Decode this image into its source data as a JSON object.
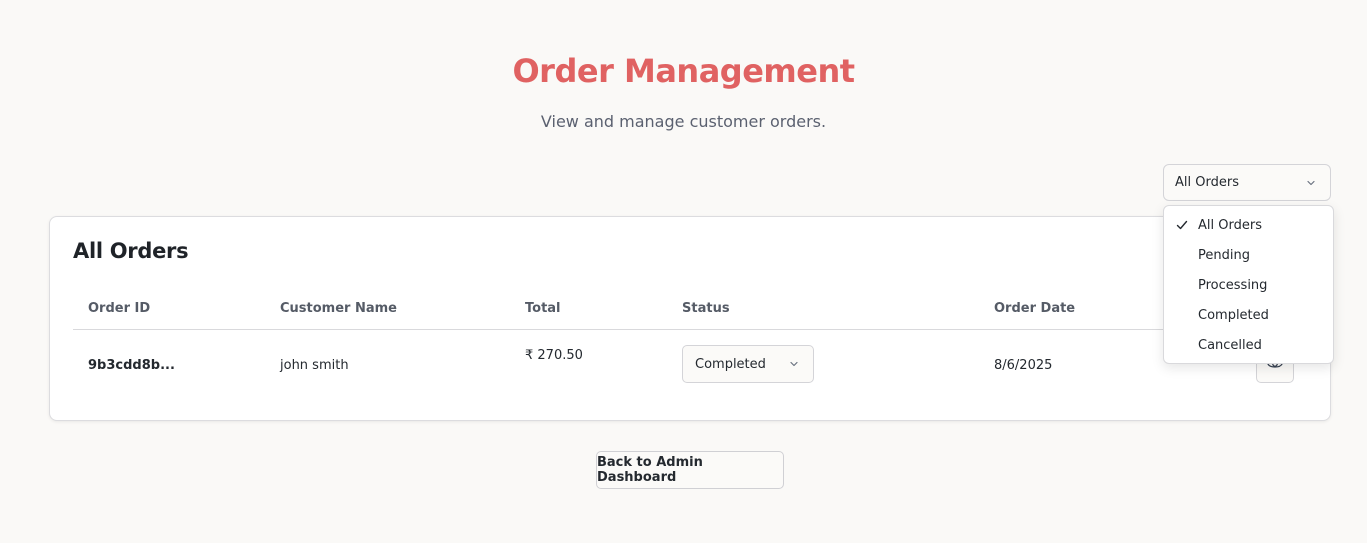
{
  "colors": {
    "accent": "#e06262"
  },
  "header": {
    "title": "Order Management",
    "subtitle": "View and manage customer orders."
  },
  "filter": {
    "selected": "All Orders",
    "options": [
      "All Orders",
      "Pending",
      "Processing",
      "Completed",
      "Cancelled"
    ]
  },
  "orders_card": {
    "title": "All Orders",
    "columns": [
      "Order ID",
      "Customer Name",
      "Total",
      "Status",
      "Order Date"
    ],
    "rows": [
      {
        "order_id": "9b3cdd8b...",
        "customer": "john smith",
        "total": "₹ 270.50",
        "status": "Completed",
        "date": "8/6/2025"
      }
    ]
  },
  "footer": {
    "back_label": "Back to Admin Dashboard"
  }
}
